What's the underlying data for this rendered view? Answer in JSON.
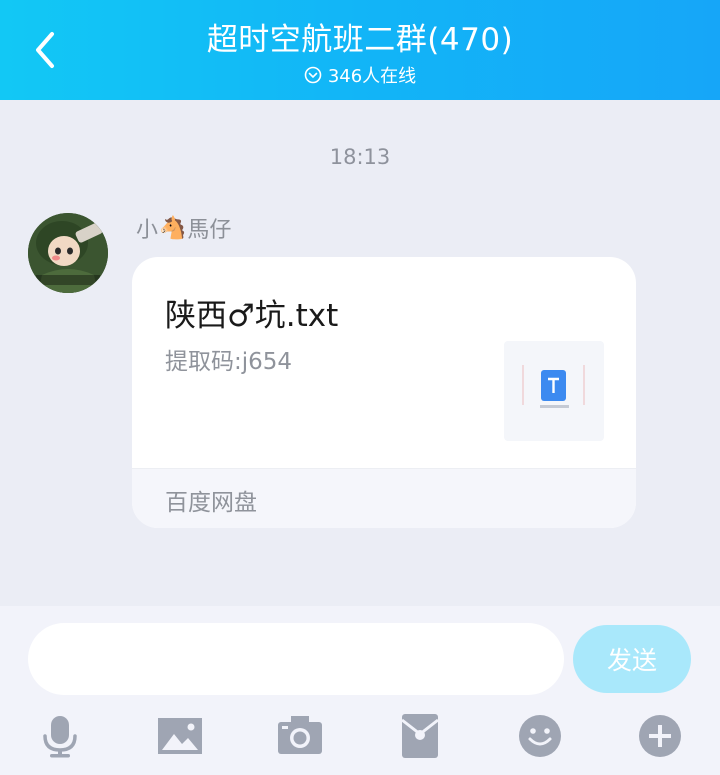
{
  "header": {
    "title": "超时空航班二群(470)",
    "online": "346人在线"
  },
  "chat": {
    "time": "18:13",
    "message": {
      "sender": "小",
      "sender_emoji": "🐴",
      "sender_suffix": "馬仔",
      "file_name": "陕西♂坑.txt",
      "code": "提取码:j654",
      "source": "百度网盘"
    }
  },
  "composer": {
    "send_label": "发送",
    "input_value": ""
  },
  "toolbar": [
    "microphone-icon",
    "image-icon",
    "camera-icon",
    "red-packet-icon",
    "emoji-icon",
    "plus-icon"
  ],
  "colors": {
    "accent": "#12b5f7",
    "icon": "#9fa5b3",
    "send_disabled": "#a9e8fb"
  }
}
